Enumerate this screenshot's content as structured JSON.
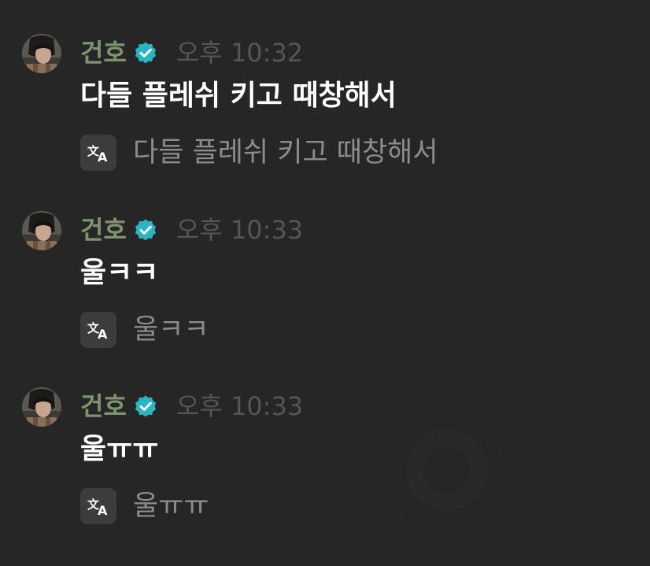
{
  "messages": [
    {
      "author": "건호",
      "time": "오후 10:32",
      "text": "다들 플레쉬 키고 때창해서",
      "translated_text": "다들 플레쉬 키고 때창해서"
    },
    {
      "author": "건호",
      "time": "오후 10:33",
      "text": "울ㅋㅋ",
      "translated_text": "울ㅋㅋ"
    },
    {
      "author": "건호",
      "time": "오후 10:33",
      "text": "울ㅠㅠ",
      "translated_text": "울ㅠㅠ"
    }
  ],
  "icons": {
    "verified": "verified-badge-icon",
    "translate": "translate-icon",
    "avatar": "profile-photo"
  },
  "colors": {
    "background": "#262626",
    "author_name": "#7d9470",
    "verified_badge": "#2ab5c2",
    "timestamp": "#555555",
    "message_text": "#ffffff",
    "translated_text": "#8c8c8c",
    "translate_icon_bg": "#3c3c3c"
  }
}
